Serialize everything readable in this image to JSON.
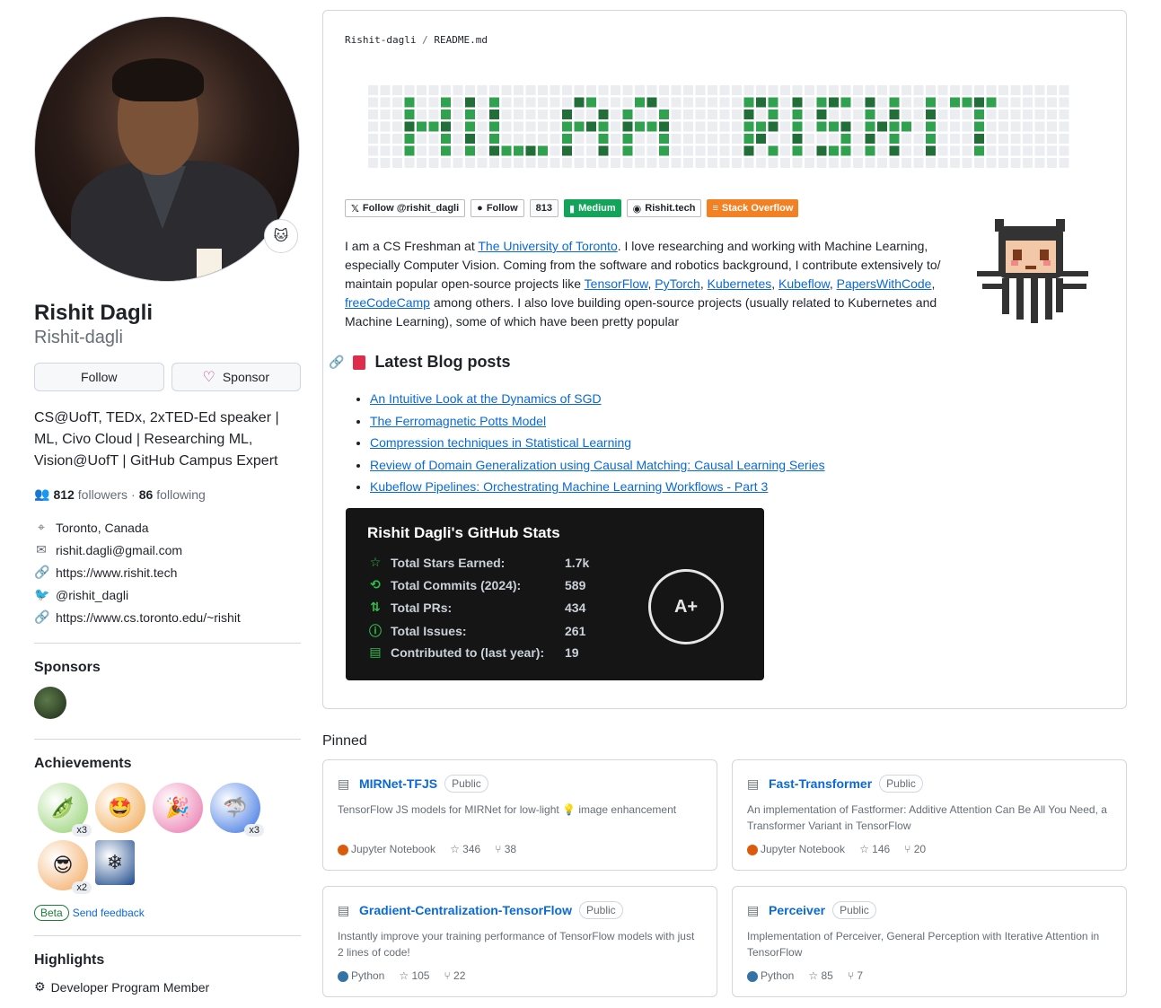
{
  "profile": {
    "full_name": "Rishit Dagli",
    "login": "Rishit-dagli",
    "follow_label": "Follow",
    "sponsor_label": "Sponsor",
    "bio": "CS@UofT, TEDx, 2xTED-Ed speaker | ML, Civo Cloud | Researching ML, Vision@UofT | GitHub Campus Expert",
    "followers": "812",
    "followers_label": "followers",
    "following": "86",
    "following_label": "following",
    "location": "Toronto, Canada",
    "email": "rishit.dagli@gmail.com",
    "website": "https://www.rishit.tech",
    "twitter": "@rishit_dagli",
    "website2": "https://www.cs.toronto.edu/~rishit"
  },
  "sponsors": {
    "title": "Sponsors"
  },
  "achievements": {
    "title": "Achievements",
    "badges": [
      {
        "icon": "pair-extraordinaire-icon",
        "count": "x3",
        "color": "#8fcf6b"
      },
      {
        "icon": "starstruck-icon",
        "count": "",
        "color": "#f0a44a"
      },
      {
        "icon": "yolo-icon",
        "count": "",
        "color": "#e86fa8"
      },
      {
        "icon": "pull-shark-icon",
        "count": "x3",
        "color": "#2f6ce0"
      },
      {
        "icon": "quickdraw-icon",
        "count": "x2",
        "color": "#f2a65a"
      },
      {
        "icon": "arctic-code-vault-icon",
        "count": "",
        "color": "#1c4a8a"
      }
    ],
    "beta_label": "Beta",
    "feedback_label": "Send feedback"
  },
  "highlights": {
    "title": "Highlights",
    "item": "Developer Program Member"
  },
  "readme": {
    "owner": "Rishit-dagli",
    "sep": " / ",
    "file": "README.md",
    "shields": [
      {
        "label": "Follow @rishit_dagli",
        "icon": "x-icon"
      },
      {
        "label": "Follow",
        "icon": "github-icon"
      },
      {
        "label": "813",
        "icon": ""
      },
      {
        "label": "Medium",
        "icon": "medium-icon"
      },
      {
        "label": "Rishit.tech",
        "icon": "globe-icon"
      },
      {
        "label": "Stack Overflow",
        "icon": "stackoverflow-icon"
      }
    ],
    "intro_a": "I am a CS Freshman at ",
    "uoft": "The University of Toronto",
    "intro_b": ". I love researching and working with Machine Learning, especially Computer Vision. Coming from the software and robotics background, I contribute extensively to/ maintain popular open-source projects like ",
    "p1": "TensorFlow",
    "p2": "PyTorch",
    "p3": "Kubernetes",
    "p4": "Kubeflow",
    "p5": "PapersWithCode",
    "p6": "freeCodeCamp",
    "intro_c": " among others. I also love building open-source projects (usually related to Kubernetes and Machine Learning), some of which have been pretty popular",
    "blog_title": "Latest Blog posts",
    "posts": [
      "An Intuitive Look at the Dynamics of SGD",
      "The Ferromagnetic Potts Model",
      "Compression techniques in Statistical Learning",
      "Review of Domain Generalization using Causal Matching: Causal Learning Series",
      "Kubeflow Pipelines: Orchestrating Machine Learning Workflows - Part 3"
    ],
    "stats": {
      "title": "Rishit Dagli's GitHub Stats",
      "rows": [
        {
          "label": "Total Stars Earned:",
          "value": "1.7k"
        },
        {
          "label": "Total Commits (2024):",
          "value": "589"
        },
        {
          "label": "Total PRs:",
          "value": "434"
        },
        {
          "label": "Total Issues:",
          "value": "261"
        },
        {
          "label": "Contributed to (last year):",
          "value": "19"
        }
      ],
      "grade": "A+"
    }
  },
  "pinned": {
    "title": "Pinned",
    "repos": [
      {
        "name": "MIRNet-TFJS",
        "vis": "Public",
        "desc": "TensorFlow JS models for MIRNet for low-light 💡 image enhancement",
        "lang": "Jupyter Notebook",
        "lang_color": "#DA5B0B",
        "stars": "346",
        "forks": "38"
      },
      {
        "name": "Fast-Transformer",
        "vis": "Public",
        "desc": "An implementation of Fastformer: Additive Attention Can Be All You Need, a Transformer Variant in TensorFlow",
        "lang": "Jupyter Notebook",
        "lang_color": "#DA5B0B",
        "stars": "146",
        "forks": "20"
      },
      {
        "name": "Gradient-Centralization-TensorFlow",
        "vis": "Public",
        "desc": "Instantly improve your training performance of TensorFlow models with just 2 lines of code!",
        "lang": "Python",
        "lang_color": "#3572A5",
        "stars": "105",
        "forks": "22"
      },
      {
        "name": "Perceiver",
        "vis": "Public",
        "desc": "Implementation of Perceiver, General Perception with Iterative Attention in TensorFlow",
        "lang": "Python",
        "lang_color": "#3572A5",
        "stars": "85",
        "forks": "7"
      }
    ]
  }
}
